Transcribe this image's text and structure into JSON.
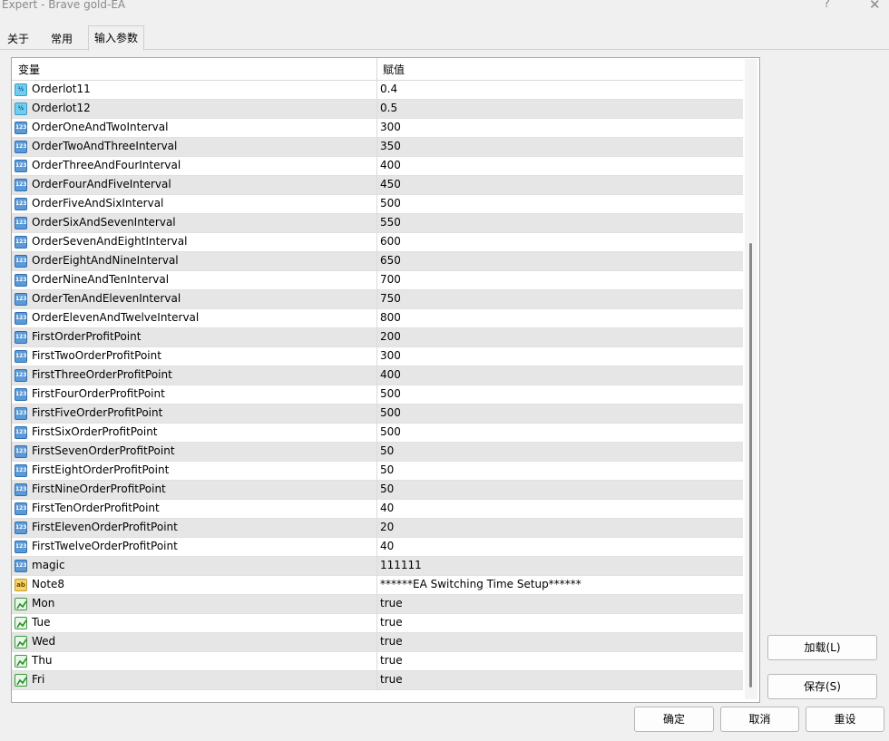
{
  "window": {
    "title": "Expert - Brave gold-EA",
    "help": "?",
    "close": "✕"
  },
  "tabs": [
    {
      "label": "关于"
    },
    {
      "label": "常用"
    },
    {
      "label": "输入参数",
      "active": true
    }
  ],
  "grid": {
    "col_variable": "变量",
    "col_value": "赋值",
    "rows": [
      {
        "icon": "double-icon",
        "name": "Orderlot11",
        "value": "0.4"
      },
      {
        "icon": "double-icon",
        "name": "Orderlot12",
        "value": "0.5"
      },
      {
        "icon": "integer-icon",
        "name": "OrderOneAndTwoInterval",
        "value": "300"
      },
      {
        "icon": "integer-icon",
        "name": "OrderTwoAndThreeInterval",
        "value": "350"
      },
      {
        "icon": "integer-icon",
        "name": "OrderThreeAndFourInterval",
        "value": "400"
      },
      {
        "icon": "integer-icon",
        "name": "OrderFourAndFiveInterval",
        "value": "450"
      },
      {
        "icon": "integer-icon",
        "name": "OrderFiveAndSixInterval",
        "value": "500"
      },
      {
        "icon": "integer-icon",
        "name": "OrderSixAndSevenInterval",
        "value": "550"
      },
      {
        "icon": "integer-icon",
        "name": "OrderSevenAndEightInterval",
        "value": "600"
      },
      {
        "icon": "integer-icon",
        "name": "OrderEightAndNineInterval",
        "value": "650"
      },
      {
        "icon": "integer-icon",
        "name": "OrderNineAndTenInterval",
        "value": "700"
      },
      {
        "icon": "integer-icon",
        "name": "OrderTenAndElevenInterval",
        "value": "750"
      },
      {
        "icon": "integer-icon",
        "name": "OrderElevenAndTwelveInterval",
        "value": "800"
      },
      {
        "icon": "integer-icon",
        "name": "FirstOrderProfitPoint",
        "value": "200"
      },
      {
        "icon": "integer-icon",
        "name": "FirstTwoOrderProfitPoint",
        "value": "300"
      },
      {
        "icon": "integer-icon",
        "name": "FirstThreeOrderProfitPoint",
        "value": "400"
      },
      {
        "icon": "integer-icon",
        "name": "FirstFourOrderProfitPoint",
        "value": "500"
      },
      {
        "icon": "integer-icon",
        "name": "FirstFiveOrderProfitPoint",
        "value": "500"
      },
      {
        "icon": "integer-icon",
        "name": "FirstSixOrderProfitPoint",
        "value": "500"
      },
      {
        "icon": "integer-icon",
        "name": "FirstSevenOrderProfitPoint",
        "value": "50"
      },
      {
        "icon": "integer-icon",
        "name": "FirstEightOrderProfitPoint",
        "value": "50"
      },
      {
        "icon": "integer-icon",
        "name": "FirstNineOrderProfitPoint",
        "value": "50"
      },
      {
        "icon": "integer-icon",
        "name": "FirstTenOrderProfitPoint",
        "value": "40"
      },
      {
        "icon": "integer-icon",
        "name": "FirstElevenOrderProfitPoint",
        "value": "20"
      },
      {
        "icon": "integer-icon",
        "name": "FirstTwelveOrderProfitPoint",
        "value": "40"
      },
      {
        "icon": "integer-icon",
        "name": "magic",
        "value": "111111"
      },
      {
        "icon": "string-icon",
        "name": "Note8",
        "value": "******EA Switching Time Setup******"
      },
      {
        "icon": "bool-icon",
        "name": "Mon",
        "value": "true"
      },
      {
        "icon": "bool-icon",
        "name": "Tue",
        "value": "true"
      },
      {
        "icon": "bool-icon",
        "name": "Wed",
        "value": "true"
      },
      {
        "icon": "bool-icon",
        "name": "Thu",
        "value": "true"
      },
      {
        "icon": "bool-icon",
        "name": "Fri",
        "value": "true"
      }
    ]
  },
  "buttons": {
    "load": "加载(L)",
    "save": "保存(S)",
    "ok": "确定",
    "cancel": "取消",
    "reset": "重设"
  },
  "colors": {
    "selected_row": "#e6e6e6",
    "window_bg": "#f0f0f0"
  }
}
